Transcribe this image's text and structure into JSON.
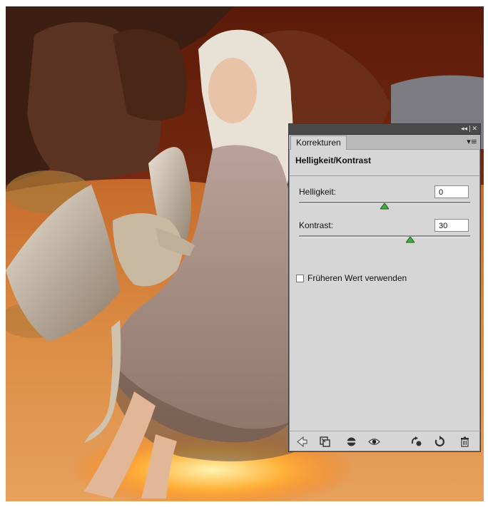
{
  "panel": {
    "tab_label": "Korrekturen",
    "title_controls": "◂◂ | ✕",
    "menu_glyph": "▾≡",
    "adjustment_title": "Helligkeit/Kontrast",
    "brightness": {
      "label": "Helligkeit:",
      "value": "0",
      "slider_fraction": 0.5
    },
    "contrast": {
      "label": "Kontrast:",
      "value": "30",
      "slider_fraction": 0.65
    },
    "legacy_checkbox": {
      "label": "Früheren Wert verwenden",
      "checked": false
    },
    "footer_icons": [
      "back-arrow-icon",
      "clip-to-layer-icon",
      "layer-visibility-icon",
      "view-previous-state-icon",
      "reset-icon",
      "refresh-icon",
      "trash-icon"
    ]
  },
  "colors": {
    "panel_bg": "#d6d6d6",
    "titlebar": "#4a4a4a",
    "slider_thumb": "#3fae3f"
  }
}
